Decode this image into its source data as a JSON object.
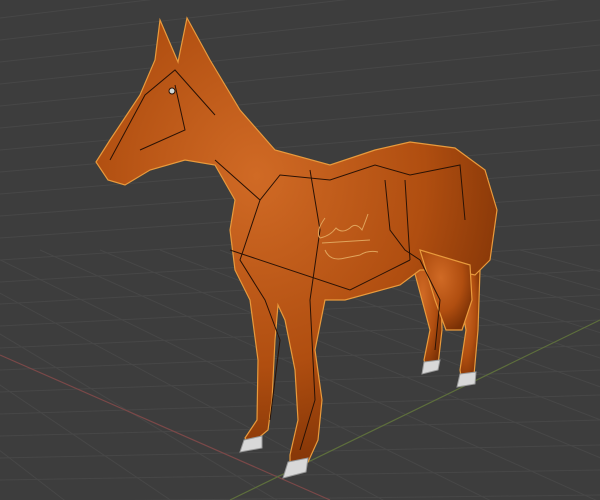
{
  "viewport": {
    "background": "#3d3d3d",
    "grid_color": "#4a4a4a",
    "x_axis_color": "#7a4a4a",
    "y_axis_color": "#5d6e3c"
  },
  "model": {
    "name": "horse",
    "body_color": "#b4500f",
    "outline_color": "#e89a3c",
    "hoof_color": "#d8d8d8",
    "signature": "Conrad Dobson"
  }
}
